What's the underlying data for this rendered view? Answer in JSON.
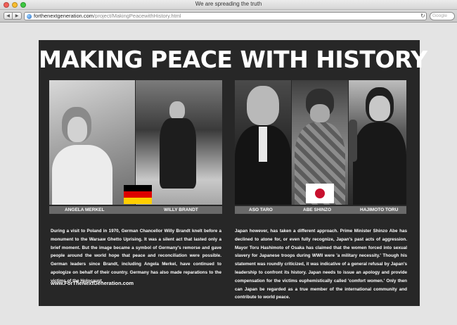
{
  "window": {
    "title": "We are spreading the truth",
    "colors": {
      "close": "#f25f58",
      "minimize": "#f9bd2e",
      "zoom": "#3dc941"
    }
  },
  "toolbar": {
    "back_icon": "back-arrow-icon",
    "forward_icon": "forward-arrow-icon",
    "url_domain": "forthenextgeneration.com",
    "url_path": "/project/MakingPeacewithHistory.html",
    "reload_icon": "reload-icon",
    "search_placeholder": "Google"
  },
  "poster": {
    "title": "MAKING PEACE WITH HISTORY",
    "captions_left": [
      "ANGELA MERKEL",
      "WILLY BRANDT"
    ],
    "captions_right": [
      "ASO TARO",
      "ABE SHINZO",
      "HAJIMOTO TORU"
    ],
    "flags": {
      "germany": [
        "#000000",
        "#dd0000",
        "#ffce00"
      ],
      "japan": [
        "#ffffff",
        "#c8102e"
      ]
    },
    "left_text": "During a visit to Poland in 1970, German Chancellor Willy Brandt knelt before a monument to the Warsaw Ghetto Uprising. It was a silent act that lasted only a brief moment. But the image became a symbol of Germany's remorse and gave people around the world hope that peace and reconciliation were possible. German leaders since Brandt, including Angela Merkel, have continued to apologize on behalf of their country. Germany has also made reparations to the victims of the Holocaust.",
    "right_text": "Japan however, has taken a different approach. Prime Minister Shinzo Abe has declined to atone for, or even fully recognize, Japan's past acts of aggression. Mayor Toru Hashimoto of Osaka has claimed that the women forced into sexual slavery for Japanese troops during WWII were 'a military necessity.' Though his statement was roundly criticized, it was indicative of a general refusal by Japan's leadership to confront its history. Japan needs to issue an apology and provide compensation for the victims euphemistically called 'comfort women.' Only then can Japan be regarded as a true member of the international community and contribute to world peace.",
    "site_link": "www.ForTheNextGeneration.com"
  }
}
